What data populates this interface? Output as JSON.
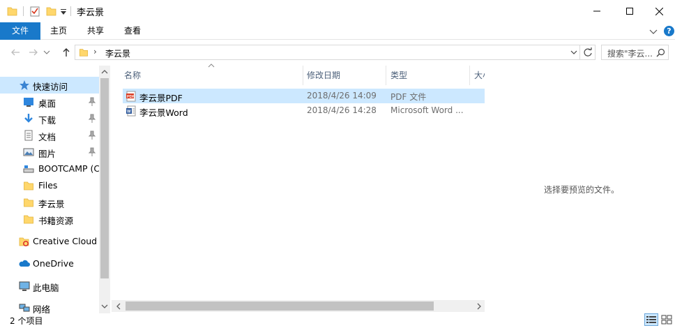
{
  "window": {
    "title": "李云景"
  },
  "ribbon": {
    "tabs": [
      "文件",
      "主页",
      "共享",
      "查看"
    ],
    "help_label": "?"
  },
  "address": {
    "path": "李云景",
    "search_placeholder": "搜索\"李云..."
  },
  "nav_pane": {
    "quick_access": "快速访问",
    "items": [
      {
        "label": "桌面",
        "icon": "desktop-icon",
        "pinned": true
      },
      {
        "label": "下载",
        "icon": "download-icon",
        "pinned": true
      },
      {
        "label": "文档",
        "icon": "document-icon",
        "pinned": true
      },
      {
        "label": "图片",
        "icon": "picture-icon",
        "pinned": true
      },
      {
        "label": "BOOTCAMP (C",
        "icon": "drive-icon",
        "pinned": false
      },
      {
        "label": "Files",
        "icon": "folder-icon",
        "pinned": false
      },
      {
        "label": "李云景",
        "icon": "folder-icon",
        "pinned": false
      },
      {
        "label": "书籍资源",
        "icon": "folder-icon",
        "pinned": false
      }
    ],
    "creative_cloud": "Creative Cloud F",
    "onedrive": "OneDrive",
    "this_pc": "此电脑",
    "network": "网络"
  },
  "file_list": {
    "columns": [
      "名称",
      "修改日期",
      "类型",
      "大小"
    ],
    "rows": [
      {
        "name": "李云景PDF",
        "date": "2018/4/26 14:09",
        "type": "PDF 文件",
        "icon": "pdf-icon",
        "selected": true
      },
      {
        "name": "李云景Word",
        "date": "2018/4/26 14:28",
        "type": "Microsoft Word ...",
        "icon": "word-icon",
        "selected": false
      }
    ]
  },
  "preview": {
    "message": "选择要预览的文件。"
  },
  "status": {
    "item_count": "2 个项目"
  },
  "colors": {
    "accent": "#1979ca",
    "selection": "#cce8ff",
    "folder": "#ffd76c"
  }
}
